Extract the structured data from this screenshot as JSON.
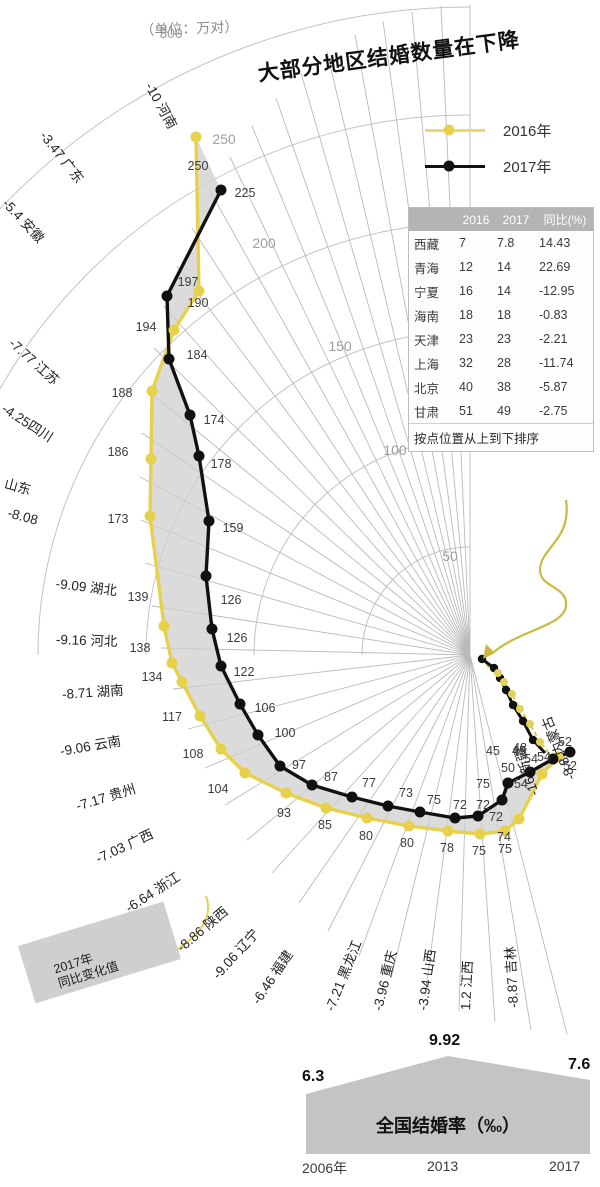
{
  "header": {
    "title": "大部分地区结婚数量在下降",
    "unit_label": "（单位：万对）"
  },
  "legend": {
    "items": [
      {
        "label": "2016年",
        "color": "#e8d14a"
      },
      {
        "label": "2017年",
        "color": "#111111"
      }
    ]
  },
  "table": {
    "headers": [
      "",
      "2016",
      "2017",
      "同比(%)"
    ],
    "rows": [
      {
        "region": "西藏",
        "y2016": "7",
        "y2017": "7.8",
        "yoy": "14.43"
      },
      {
        "region": "青海",
        "y2016": "12",
        "y2017": "14",
        "yoy": "22.69"
      },
      {
        "region": "宁夏",
        "y2016": "16",
        "y2017": "14",
        "yoy": "-12.95"
      },
      {
        "region": "海南",
        "y2016": "18",
        "y2017": "18",
        "yoy": "-0.83"
      },
      {
        "region": "天津",
        "y2016": "23",
        "y2017": "23",
        "yoy": "-2.21"
      },
      {
        "region": "上海",
        "y2016": "32",
        "y2017": "28",
        "yoy": "-11.74"
      },
      {
        "region": "北京",
        "y2016": "40",
        "y2017": "38",
        "yoy": "-5.87"
      },
      {
        "region": "甘肃",
        "y2016": "51",
        "y2017": "49",
        "yoy": "-2.75"
      }
    ],
    "note": "按点位置从上到下排序"
  },
  "annotation": {
    "line1": "2017年",
    "line2": "同比变化值"
  },
  "chart_data": {
    "type": "line",
    "title": "大部分地区结婚数量在下降",
    "ylabel": "万对",
    "radial_ticks": [
      "300",
      "250",
      "200",
      "150",
      "100",
      "50"
    ],
    "categories": [
      "河南",
      "广东",
      "安徽",
      "江苏",
      "四川",
      "山东",
      "湖北",
      "河北",
      "湖南",
      "云南",
      "贵州",
      "广西",
      "浙江",
      "陕西",
      "辽宁",
      "福建",
      "黑龙江",
      "重庆",
      "山西",
      "江西",
      "吉林",
      "新疆",
      "内蒙古"
    ],
    "spoke_labels": [
      {
        "name": "河南",
        "yoy": "-10"
      },
      {
        "name": "广东",
        "yoy": "-3.47"
      },
      {
        "name": "安徽",
        "yoy": "-5.4"
      },
      {
        "name": "江苏",
        "yoy": "-7.77"
      },
      {
        "name": "四川",
        "yoy": "-4.25"
      },
      {
        "name": "山东",
        "yoy": "-8.08"
      },
      {
        "name": "湖北",
        "yoy": "-9.09"
      },
      {
        "name": "河北",
        "yoy": "-9.16"
      },
      {
        "name": "湖南",
        "yoy": "-8.71"
      },
      {
        "name": "云南",
        "yoy": "-9.06"
      },
      {
        "name": "贵州",
        "yoy": "-7.17"
      },
      {
        "name": "广西",
        "yoy": "-7.03"
      },
      {
        "name": "浙江",
        "yoy": "-6.64"
      },
      {
        "name": "陕西",
        "yoy": "-8.86"
      },
      {
        "name": "辽宁",
        "yoy": "-9.06"
      },
      {
        "name": "福建",
        "yoy": "-6.46"
      },
      {
        "name": "黑龙江",
        "yoy": "-7.21"
      },
      {
        "name": "重庆",
        "yoy": "-3.96"
      },
      {
        "name": "山西",
        "yoy": "-3.94"
      },
      {
        "name": "江西",
        "yoy": "1.2"
      },
      {
        "name": "吉林",
        "yoy": "-8.87"
      },
      {
        "name": "新疆",
        "yoy": "-16"
      },
      {
        "name": "内蒙古",
        "yoy": "-8.8"
      }
    ],
    "series": [
      {
        "name": "2016年",
        "color": "#e8d14a",
        "values": [
          250,
          197,
          194,
          188,
          186,
          173,
          139,
          138,
          134,
          117,
          108,
          104,
          93,
          85,
          80,
          80,
          78,
          75,
          75,
          74,
          54,
          54,
          52
        ]
      },
      {
        "name": "2017年",
        "color": "#111111",
        "values": [
          225,
          190,
          184,
          174,
          178,
          159,
          126,
          126,
          122,
          106,
          100,
          97,
          87,
          77,
          73,
          75,
          72,
          72,
          72,
          75,
          54,
          50,
          45
        ]
      }
    ],
    "extra_point_labels": {
      "black_center": [
        "45",
        "48",
        "50",
        "54"
      ],
      "yellow_center": [
        "52",
        "54",
        "54"
      ]
    }
  },
  "bottom_chart": {
    "type": "area",
    "title": "全国结婚率（‰）",
    "categories": [
      "2006年",
      "2013",
      "2017"
    ],
    "values": [
      6.3,
      9.92,
      7.6
    ],
    "value_labels": [
      "6.3",
      "9.92",
      "7.6"
    ]
  }
}
